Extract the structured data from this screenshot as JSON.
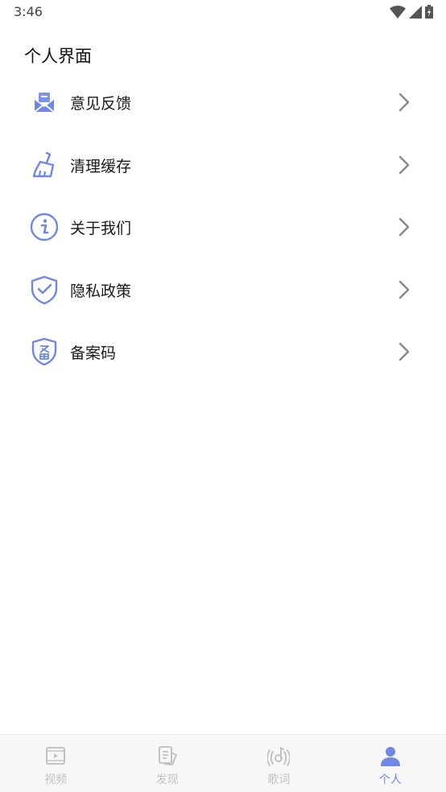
{
  "status_bar": {
    "time": "3:46"
  },
  "page": {
    "title": "个人界面"
  },
  "menu": {
    "items": [
      {
        "label": "意见反馈",
        "icon": "feedback-envelope-icon"
      },
      {
        "label": "清理缓存",
        "icon": "broom-icon"
      },
      {
        "label": "关于我们",
        "icon": "info-icon"
      },
      {
        "label": "隐私政策",
        "icon": "shield-check-icon"
      },
      {
        "label": "备案码",
        "icon": "record-badge-icon"
      }
    ]
  },
  "tabbar": {
    "tabs": [
      {
        "label": "视频",
        "icon": "video-icon"
      },
      {
        "label": "发现",
        "icon": "discover-icon"
      },
      {
        "label": "歌词",
        "icon": "lyrics-icon"
      },
      {
        "label": "个人",
        "icon": "person-icon",
        "active": true
      }
    ]
  },
  "colors": {
    "accent": "#6f87e6",
    "inactive": "#c2c2c2",
    "arrow": "#888888"
  }
}
